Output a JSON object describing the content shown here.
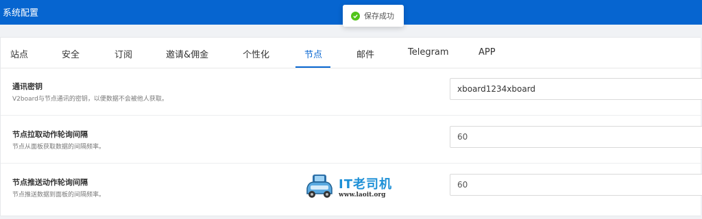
{
  "header": {
    "title": "系统配置"
  },
  "toast": {
    "text": "保存成功",
    "status_color": "#52c41a"
  },
  "tabs": [
    {
      "label": "站点"
    },
    {
      "label": "安全"
    },
    {
      "label": "订阅"
    },
    {
      "label": "邀请&佣金"
    },
    {
      "label": "个性化"
    },
    {
      "label": "节点",
      "active": true
    },
    {
      "label": "邮件"
    },
    {
      "label": "Telegram"
    },
    {
      "label": "APP"
    }
  ],
  "settings": [
    {
      "label": "通讯密钥",
      "description": "V2board与节点通讯的密钥，以便数据不会被他人获取。",
      "value": "xboard1234xboard"
    },
    {
      "label": "节点拉取动作轮询间隔",
      "description": "节点从面板获取数据的间隔频率。",
      "value": "60"
    },
    {
      "label": "节点推送动作轮询间隔",
      "description": "节点推送数据到面板的间隔频率。",
      "value": "60"
    }
  ],
  "watermark": {
    "title": "IT老司机",
    "url": "www.laoit.org"
  },
  "colors": {
    "primary": "#0665d0",
    "success": "#52c41a"
  }
}
